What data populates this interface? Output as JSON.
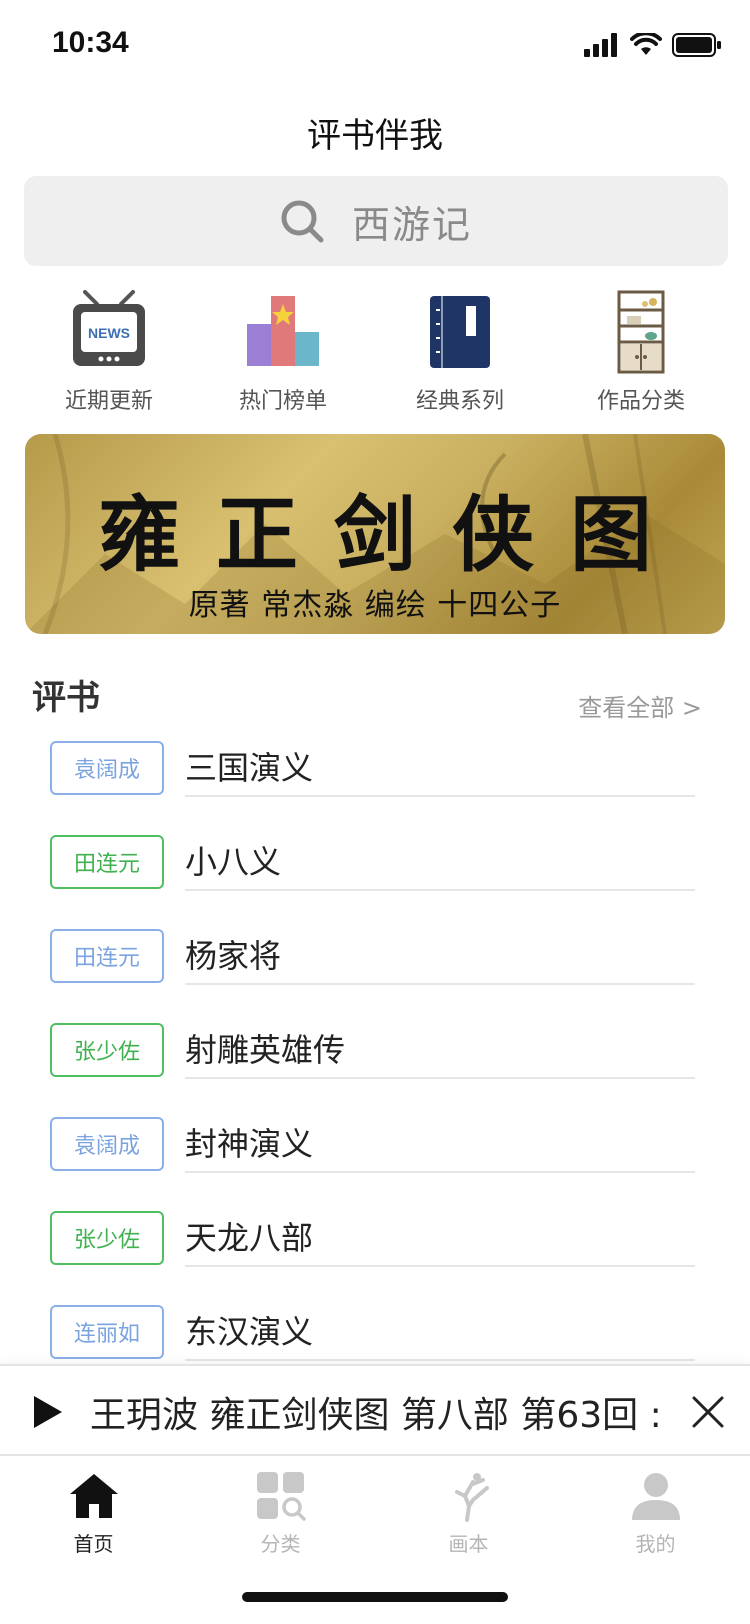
{
  "status": {
    "time": "10:34",
    "icons": [
      "cellular-signal-icon",
      "wifi-icon",
      "battery-icon"
    ]
  },
  "header": {
    "title": "评书伴我"
  },
  "search": {
    "placeholder": "西游记",
    "icon": "search-icon"
  },
  "quick_links": [
    {
      "label": "近期更新",
      "icon": "tv-news-icon"
    },
    {
      "label": "热门榜单",
      "icon": "podium-ranking-icon"
    },
    {
      "label": "经典系列",
      "icon": "book-icon"
    },
    {
      "label": "作品分类",
      "icon": "bookshelf-icon"
    }
  ],
  "banner": {
    "title": "雍正剑侠图",
    "subtitle": "原著 常杰淼  编绘  十四公子"
  },
  "section": {
    "title": "评书",
    "more": "查看全部 >"
  },
  "books": [
    {
      "author": "袁阔成",
      "title": "三国演义",
      "tag_color": "blue"
    },
    {
      "author": "田连元",
      "title": "小八义",
      "tag_color": "green"
    },
    {
      "author": "田连元",
      "title": "杨家将",
      "tag_color": "blue"
    },
    {
      "author": "张少佐",
      "title": "射雕英雄传",
      "tag_color": "green"
    },
    {
      "author": "袁阔成",
      "title": "封神演义",
      "tag_color": "blue"
    },
    {
      "author": "张少佐",
      "title": "天龙八部",
      "tag_color": "green"
    },
    {
      "author": "连丽如",
      "title": "东汉演义",
      "tag_color": "blue"
    }
  ],
  "player": {
    "now_playing": "王玥波 雍正剑侠图 第八部 第63回 :"
  },
  "tabs": [
    {
      "label": "首页",
      "icon": "home-icon",
      "active": true
    },
    {
      "label": "分类",
      "icon": "category-search-icon",
      "active": false
    },
    {
      "label": "画本",
      "icon": "kick-figure-icon",
      "active": false
    },
    {
      "label": "我的",
      "icon": "profile-icon",
      "active": false
    }
  ],
  "colors": {
    "tag_blue": "#7aa3e0",
    "tag_green": "#3fb24f",
    "banner_gold": "#c9b060"
  }
}
